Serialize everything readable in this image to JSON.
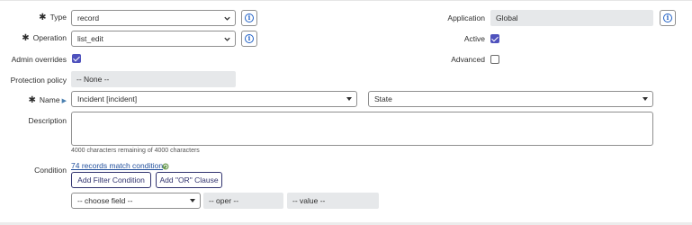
{
  "form": {
    "type": {
      "label": "Type",
      "value": "record"
    },
    "operation": {
      "label": "Operation",
      "value": "list_edit"
    },
    "admin_overrides": {
      "label": "Admin overrides",
      "checked": true
    },
    "protection_policy": {
      "label": "Protection policy",
      "value": "-- None --"
    },
    "name": {
      "label": "Name",
      "table_value": "Incident [incident]",
      "field_value": "State"
    },
    "description": {
      "label": "Description",
      "value": "",
      "counter": "4000 characters remaining of 4000 characters"
    },
    "application": {
      "label": "Application",
      "value": "Global"
    },
    "active": {
      "label": "Active",
      "checked": true
    },
    "advanced": {
      "label": "Advanced",
      "checked": false
    },
    "condition": {
      "label": "Condition",
      "match_link": "74 records match condition",
      "add_filter_label": "Add Filter Condition",
      "add_or_label": "Add \"OR\" Clause",
      "choose_field": "-- choose field --",
      "oper": "-- oper --",
      "value": "-- value --"
    }
  },
  "colors": {
    "accent": "#4f52bd",
    "button_text": "#31336f",
    "link": "#1f4e9c",
    "readonly_bg": "#e6e8ea"
  }
}
